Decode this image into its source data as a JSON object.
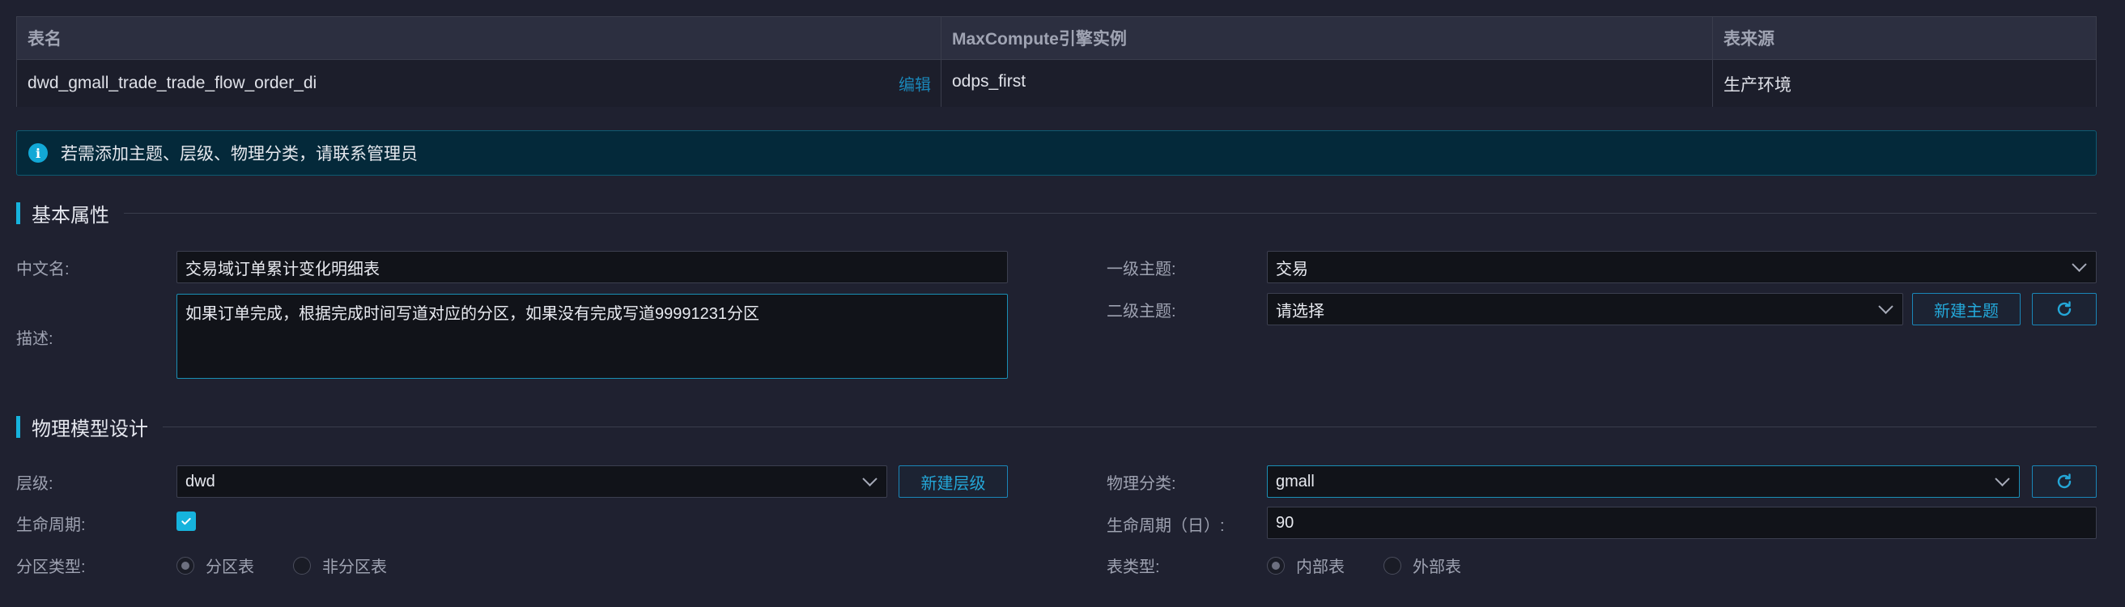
{
  "table": {
    "headers": [
      "表名",
      "MaxCompute引擎实例",
      "表来源"
    ],
    "row": {
      "table_name": "dwd_gmall_trade_trade_flow_order_di",
      "edit_label": "编辑",
      "engine_instance": "odps_first",
      "source": "生产环境"
    }
  },
  "alert": {
    "icon": "info-icon",
    "text": "若需添加主题、层级、物理分类，请联系管理员"
  },
  "basic": {
    "section_title": "基本属性",
    "chinese_name_label": "中文名:",
    "chinese_name_value": "交易域订单累计变化明细表",
    "description_label": "描述:",
    "description_value": "如果订单完成，根据完成时间写道对应的分区，如果没有完成写道99991231分区",
    "level1_topic_label": "一级主题:",
    "level1_topic_value": "交易",
    "level2_topic_label": "二级主题:",
    "level2_topic_value": "请选择",
    "new_topic_button": "新建主题"
  },
  "physical": {
    "section_title": "物理模型设计",
    "layer_label": "层级:",
    "layer_value": "dwd",
    "new_layer_button": "新建层级",
    "lifecycle_label": "生命周期:",
    "lifecycle_checked": true,
    "partition_type_label": "分区类型:",
    "partition_options": [
      "分区表",
      "非分区表"
    ],
    "partition_selected": "分区表",
    "physical_category_label": "物理分类:",
    "physical_category_value": "gmall",
    "lifecycle_days_label": "生命周期（日）:",
    "lifecycle_days_value": "90",
    "table_type_label": "表类型:",
    "table_type_options": [
      "内部表",
      "外部表"
    ],
    "table_type_selected": "内部表"
  },
  "colors": {
    "accent": "#16b3dd",
    "link": "#1a86b8",
    "background": "#1f2130",
    "alert_bg": "#04293a"
  }
}
